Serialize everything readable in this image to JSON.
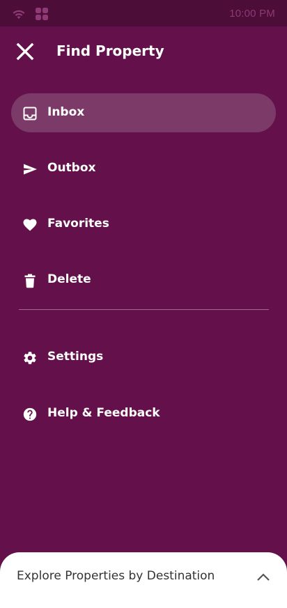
{
  "status_bar": {
    "time": "10:00 PM",
    "icons": [
      "wifi-icon",
      "apps-icon"
    ]
  },
  "header": {
    "title": "Find Property",
    "close_icon": "close-icon"
  },
  "nav": {
    "items": [
      {
        "label": "Inbox",
        "icon": "inbox-icon",
        "active": true
      },
      {
        "label": "Outbox",
        "icon": "send-icon",
        "active": false
      },
      {
        "label": "Favorites",
        "icon": "heart-icon",
        "active": false
      },
      {
        "label": "Delete",
        "icon": "trash-icon",
        "active": false
      }
    ],
    "secondary_items": [
      {
        "label": "Settings",
        "icon": "gear-icon"
      },
      {
        "label": "Help & Feedback",
        "icon": "help-icon"
      }
    ]
  },
  "bottom_sheet": {
    "label": "Explore Properties by Destination",
    "icon": "chevron-up-icon"
  },
  "colors": {
    "drawer_background": "#64104a",
    "status_bar_background": "#4c0d38",
    "active_item_background": "#7b3a68",
    "status_text": "#8f3a75"
  }
}
